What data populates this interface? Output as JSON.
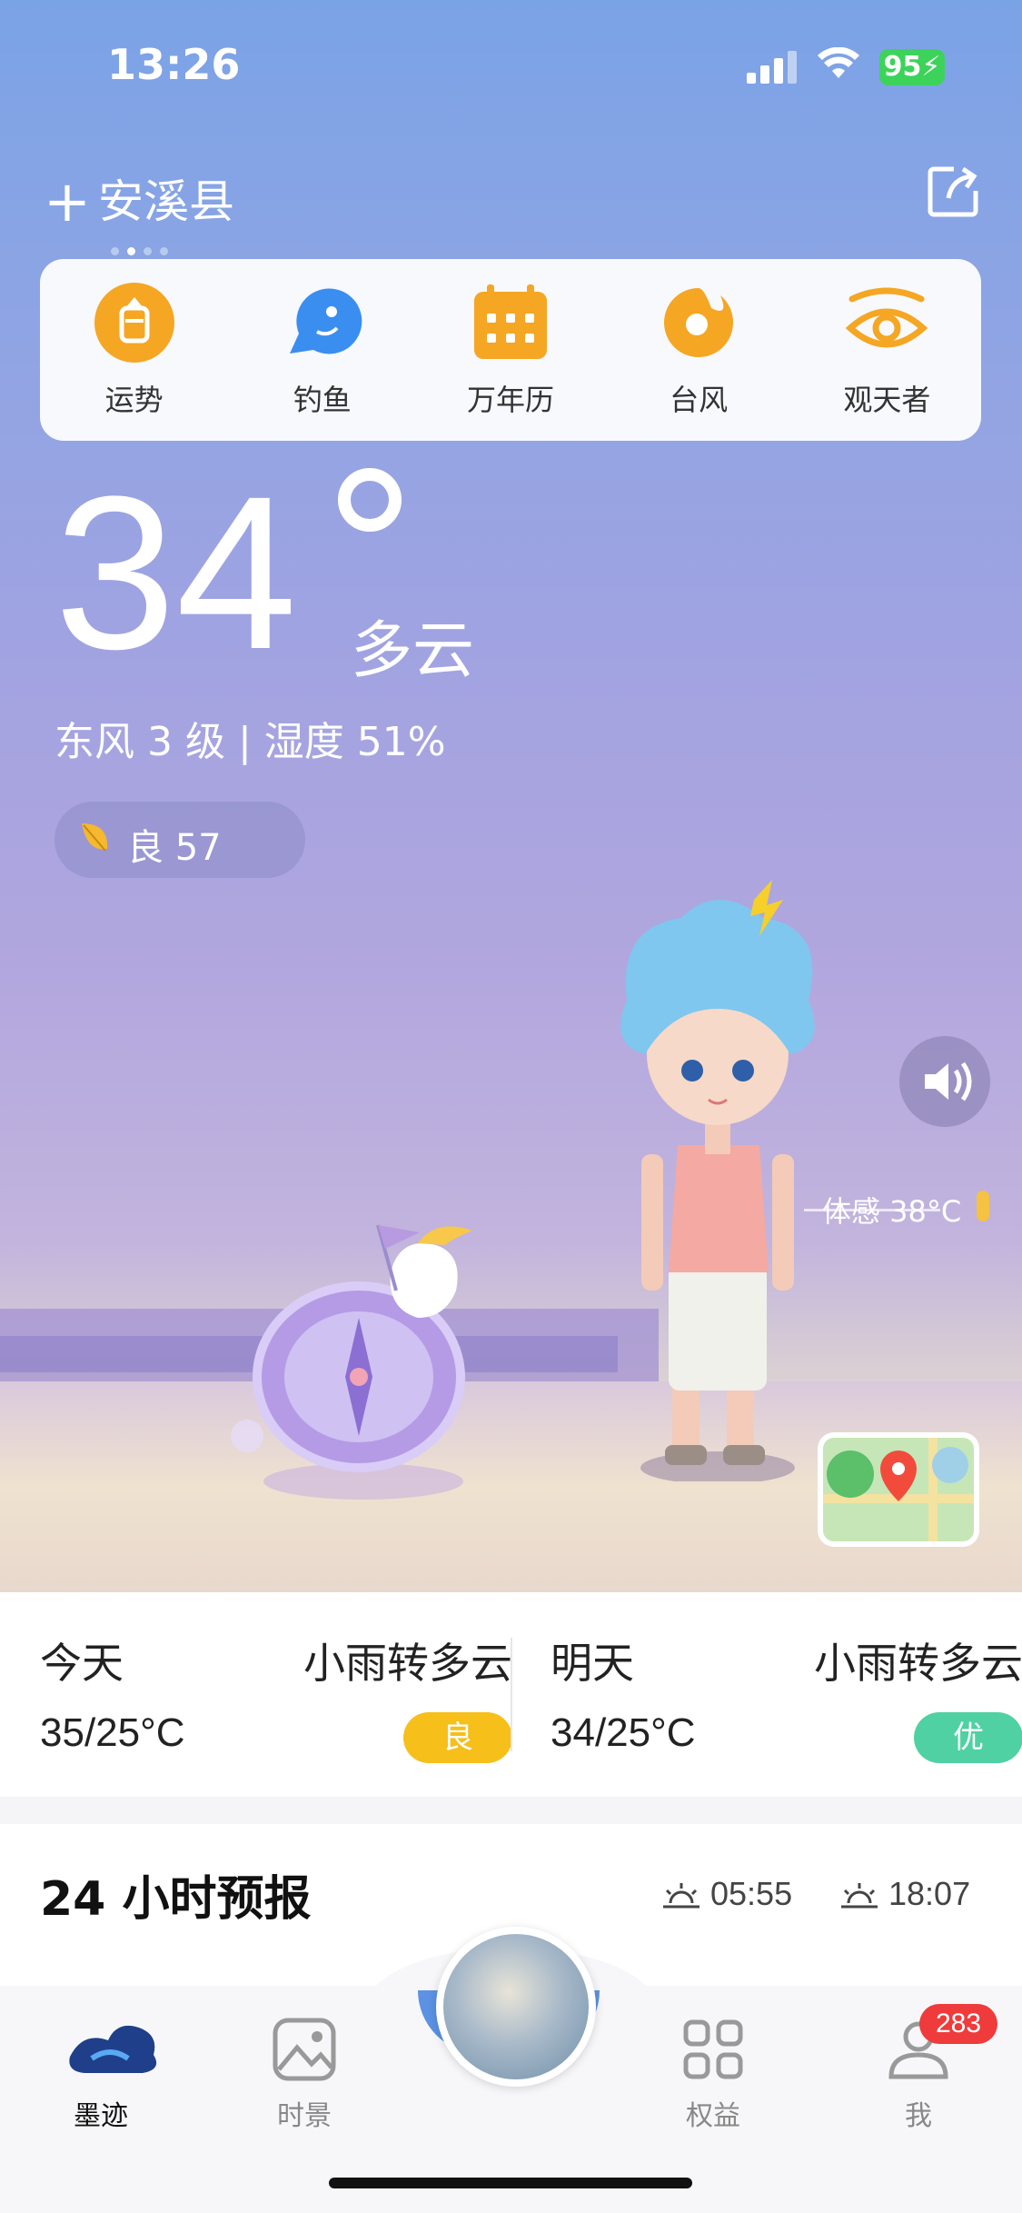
{
  "status": {
    "time": "13:26",
    "battery": "95"
  },
  "header": {
    "plus": "+",
    "city": "安溪县"
  },
  "quick_actions": [
    {
      "label": "运势",
      "icon": "fortune-icon"
    },
    {
      "label": "钓鱼",
      "icon": "fishing-icon"
    },
    {
      "label": "万年历",
      "icon": "calendar-icon"
    },
    {
      "label": "台风",
      "icon": "typhoon-icon"
    },
    {
      "label": "观天者",
      "icon": "eye-icon"
    }
  ],
  "current": {
    "temp": "34",
    "condition": "多云",
    "wind_humidity": "东风 3 级 | 湿度 51%",
    "aqi": "良 57",
    "feels_like": "体感 38°C"
  },
  "days": [
    {
      "name": "今天",
      "condition": "小雨转多云",
      "range": "35/25°C",
      "aq": "良",
      "aq_color": "#f6bf1a"
    },
    {
      "name": "明天",
      "condition": "小雨转多云",
      "range": "34/25°C",
      "aq": "优",
      "aq_color": "#4fd1a3"
    }
  ],
  "forecast": {
    "title": "24 小时预报",
    "sunrise": "05:55",
    "sunset": "18:07"
  },
  "tabbar": {
    "tabs": [
      {
        "label": "墨迹"
      },
      {
        "label": "时景"
      },
      {
        "label": "权益"
      },
      {
        "label": "我"
      }
    ],
    "badge": "283"
  }
}
